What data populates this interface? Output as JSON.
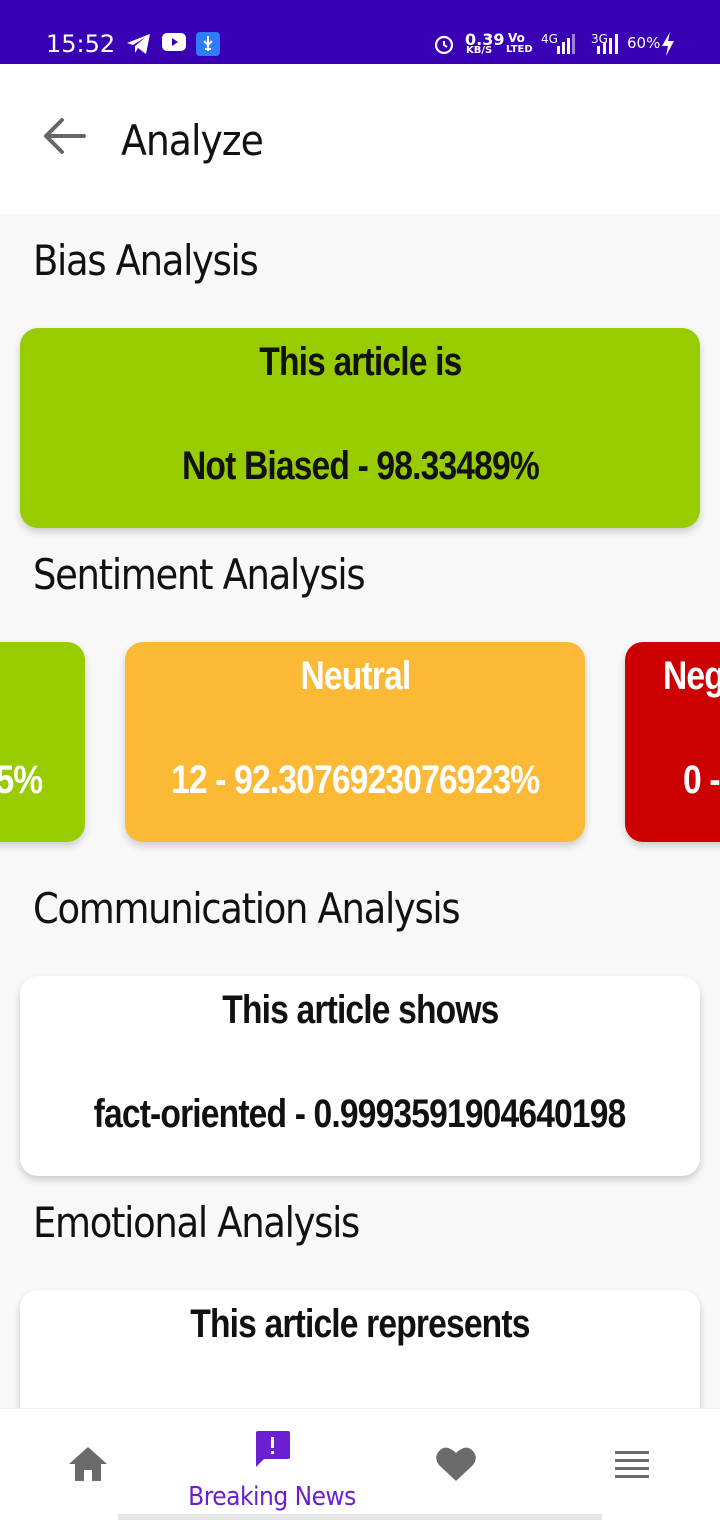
{
  "status_bar": {
    "time": "15:52",
    "speed_value": "0.39",
    "speed_unit": "KB/S",
    "volte_top": "Vo",
    "volte_bottom": "LTED",
    "network_4g": "4G",
    "network_3g": "3G",
    "battery": "60%"
  },
  "app_bar": {
    "title": "Analyze",
    "back_icon": "arrow-back-icon"
  },
  "sections": {
    "bias": {
      "title": "Bias Analysis",
      "line1": "This article is",
      "line2": "Not Biased - 98.33489%"
    },
    "sentiment": {
      "title": "Sentiment Analysis",
      "cards": [
        {
          "label": "",
          "value": "5%",
          "color": "#99cc00"
        },
        {
          "label": "Neutral",
          "value": "12 - 92.3076923076923%",
          "color": "#fbb935"
        },
        {
          "label": "Neg",
          "value": "0 -",
          "color": "#cc0000"
        }
      ]
    },
    "communication": {
      "title": "Communication Analysis",
      "line1": "This article shows",
      "line2": "fact-oriented - 0.9993591904640198"
    },
    "emotional": {
      "title": "Emotional Analysis",
      "line1": "This article represents"
    }
  },
  "bottom_nav": {
    "items": [
      {
        "icon": "home-icon",
        "label": ""
      },
      {
        "icon": "breaking-news-icon",
        "label": "Breaking News"
      },
      {
        "icon": "heart-icon",
        "label": ""
      },
      {
        "icon": "menu-icon",
        "label": ""
      }
    ],
    "active_color": "#6a1fd0",
    "inactive_color": "#6b6b6b"
  },
  "colors": {
    "status_bar": "#3a00b3",
    "positive": "#99cc00",
    "neutral": "#fbb935",
    "negative": "#cc0000"
  }
}
